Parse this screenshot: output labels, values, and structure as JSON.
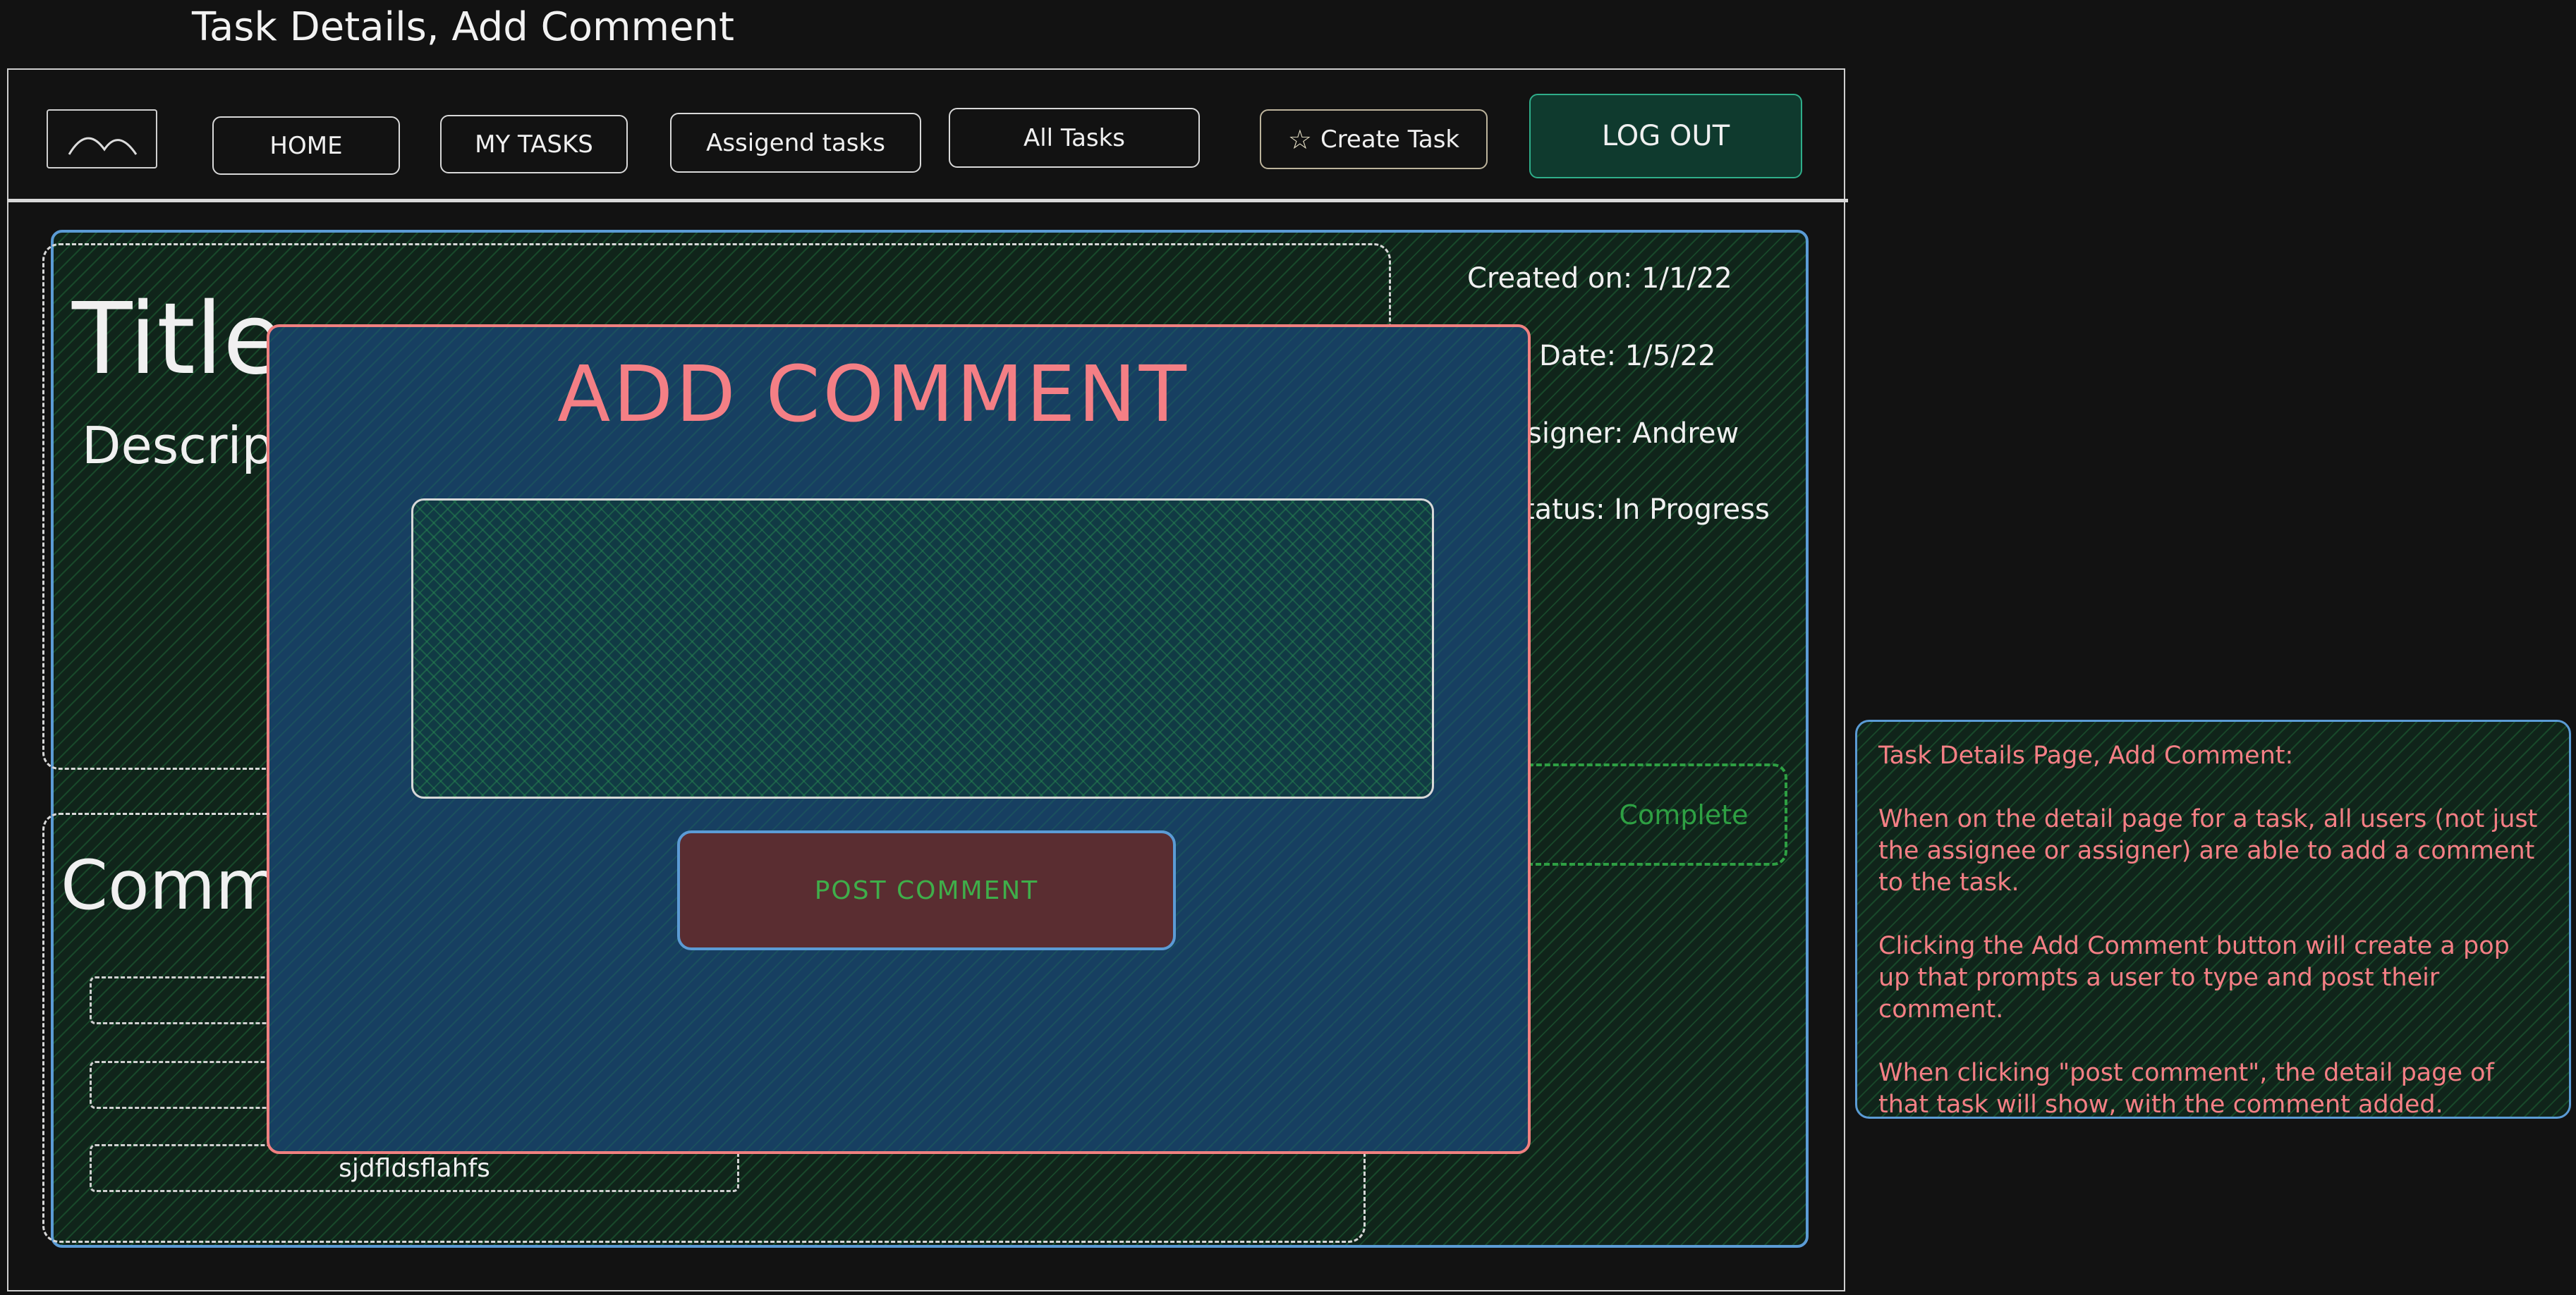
{
  "page_title": "Task Details, Add Comment",
  "nav": {
    "logo_icon": "mountain-logo-icon",
    "home": "HOME",
    "my_tasks": "MY TASKS",
    "assigned_tasks": "Assigend tasks",
    "all_tasks": "All Tasks",
    "create_task": "Create Task",
    "create_task_icon": "star-icon",
    "logout": "LOG OUT"
  },
  "task": {
    "title": "Title",
    "description": "Descrip",
    "created_on": "Created on: 1/1/22",
    "due_date": "Date: 1/5/22",
    "assigner": "signer: Andrew",
    "status": "tatus: In Progress",
    "complete_label": "Complete"
  },
  "comments": {
    "heading": "Comme",
    "items": [
      "",
      "",
      "sjdfldsflahfs"
    ]
  },
  "modal": {
    "title": "ADD COMMENT",
    "textarea_value": "",
    "post_label": "POST COMMENT"
  },
  "note": {
    "heading": "Task Details Page, Add Comment:",
    "para1": "When on the detail page for a task, all users (not just the assignee or assigner) are able to add a comment to the task.",
    "para2": "Clicking the Add Comment button will create a pop up that prompts a user to type and post their comment.",
    "para3": "When clicking \"post comment\", the detail page of that task will show, with the comment added."
  },
  "colors": {
    "background": "#121212",
    "panel_border": "#5b9bd5",
    "modal_bg": "#173f61",
    "modal_border": "#f08080",
    "modal_title": "#f47f85",
    "post_button_bg": "#5a2d31",
    "post_button_text": "#3fae4a",
    "complete_green": "#2ea043",
    "logout_bg": "#0f3a2e",
    "note_text": "#f47f85"
  }
}
